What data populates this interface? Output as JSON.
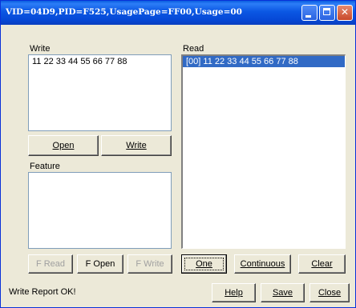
{
  "window": {
    "title": "VID=04D9,PID=F525,UsagePage=FF00,Usage=00"
  },
  "write": {
    "label": "Write",
    "content": "11 22 33 44 55 66 77 88",
    "open_button": "Open",
    "write_button": "Write"
  },
  "feature": {
    "label": "Feature",
    "content": "",
    "fread_button": "F Read",
    "fopen_button": "F Open",
    "fwrite_button": "F Write"
  },
  "read": {
    "label": "Read",
    "items": [
      {
        "text": "[00]    11 22 33 44 55 66 77 88",
        "selected": true
      }
    ],
    "one_button": "One",
    "continuous_button": "Continuous",
    "clear_button": "Clear"
  },
  "footer": {
    "status": "Write Report OK!",
    "help_button": "Help",
    "save_button": "Save",
    "close_button": "Close"
  }
}
